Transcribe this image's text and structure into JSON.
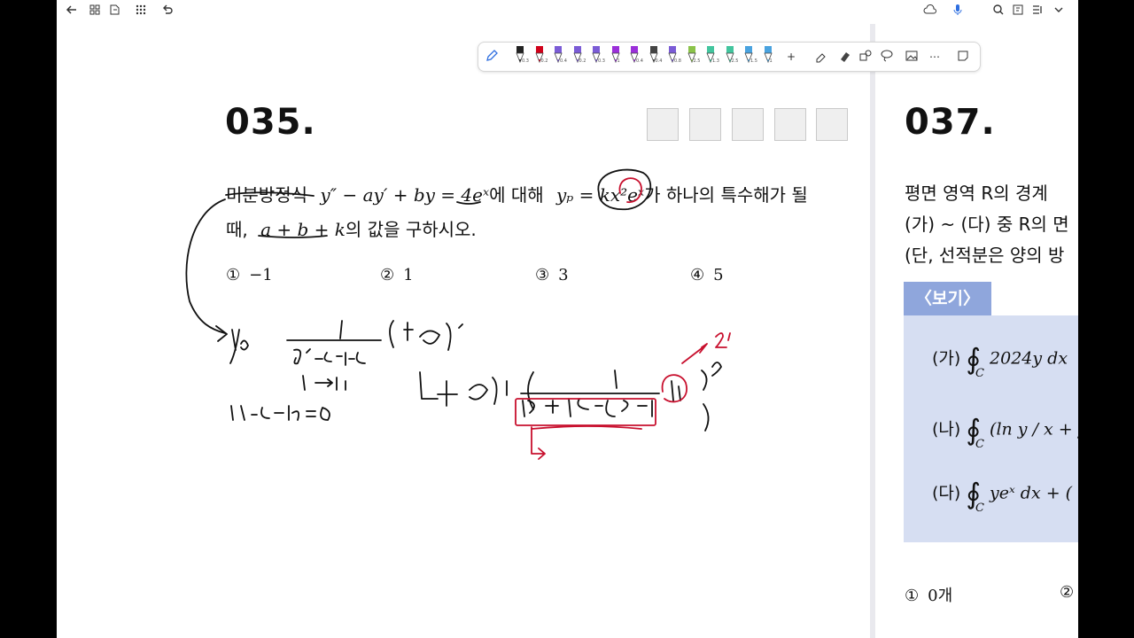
{
  "toolbar": {
    "pens": [
      {
        "color": "#222222",
        "size": "0.3"
      },
      {
        "color": "#d0021b",
        "size": "0.2"
      },
      {
        "color": "#7b5cd6",
        "size": "0.4"
      },
      {
        "color": "#7b5cd6",
        "size": "0.2"
      },
      {
        "color": "#7b5cd6",
        "size": "0.3"
      },
      {
        "color": "#9b30d9",
        "size": "1"
      },
      {
        "color": "#9b30d9",
        "size": "0.4"
      },
      {
        "color": "#444444",
        "size": "0.4"
      },
      {
        "color": "#7b5cd6",
        "size": "0.8"
      },
      {
        "color": "#8bc34a",
        "size": "2.5"
      },
      {
        "color": "#43c59e",
        "size": "1.3"
      },
      {
        "color": "#43c59e",
        "size": "2.5"
      },
      {
        "color": "#4aa3df",
        "size": "1.5"
      },
      {
        "color": "#4aa3df",
        "size": "1"
      }
    ]
  },
  "left_page": {
    "question_number": "035.",
    "question_line1_prefix": "미분방정식",
    "equation1": "y″ − ay′ + by = 4eˣ",
    "question_line1_mid": "에 대해",
    "equation2": "yₚ = kx²eˣ",
    "question_line1_suffix": "가 하나의 특수해가 될",
    "question_line2_prefix": "때,",
    "equation3": "a + b + k",
    "question_line2_suffix": "의 값을 구하시오.",
    "choices": [
      {
        "num": "①",
        "value": "−1"
      },
      {
        "num": "②",
        "value": "1"
      },
      {
        "num": "③",
        "value": "3"
      },
      {
        "num": "④",
        "value": "5"
      }
    ]
  },
  "right_page": {
    "question_number": "037.",
    "line1": "평면 영역  R의 경계",
    "line2": "(가) ~ (다) 중  R의 면",
    "line3": "(단, 선적분은 양의 방",
    "bogi_label": "〈보기〉",
    "items": [
      {
        "label": "(가)",
        "expr": "2024y dx"
      },
      {
        "label": "(나)",
        "expr": "(ln y / x + y"
      },
      {
        "label": "(다)",
        "expr": "yeˣ dx + ("
      }
    ],
    "choice_first": {
      "num": "①",
      "value": "0개"
    },
    "choice_second_num": "②"
  }
}
